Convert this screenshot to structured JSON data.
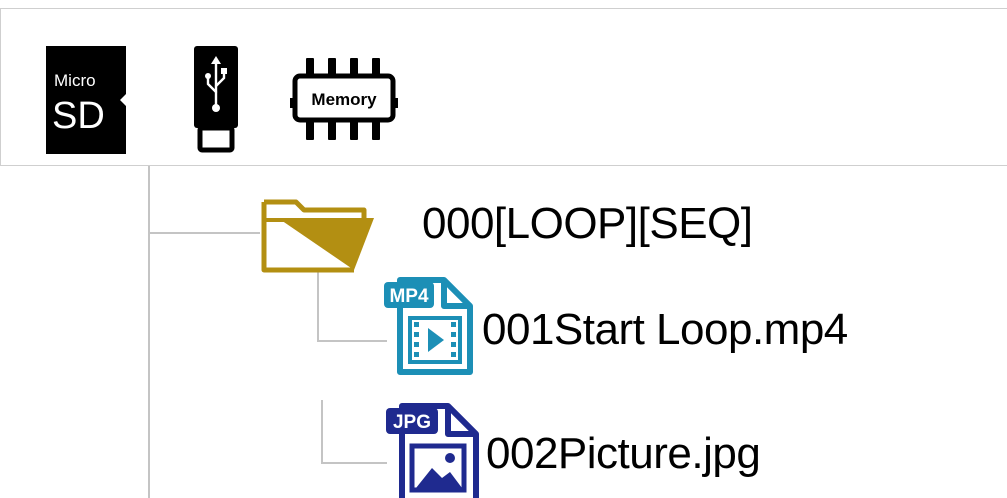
{
  "storage_toolbar": {
    "items": [
      {
        "name": "microsd",
        "icon": "microsd-card-icon",
        "text_top": "Micro",
        "text_bottom": "SD"
      },
      {
        "name": "usb",
        "icon": "usb-drive-icon"
      },
      {
        "name": "memory",
        "icon": "memory-chip-icon",
        "text": "Memory"
      }
    ]
  },
  "file_tree": {
    "folder": {
      "name": "000[LOOP][SEQ]",
      "icon": "folder-open-icon",
      "color": "#b38f12"
    },
    "files": [
      {
        "name": "001Start Loop.mp4",
        "badge": "MP4",
        "icon": "video-file-icon",
        "color": "#1c8fb6"
      },
      {
        "name": "002Picture.jpg",
        "badge": "JPG",
        "icon": "image-file-icon",
        "color": "#1f2a8f"
      }
    ]
  }
}
